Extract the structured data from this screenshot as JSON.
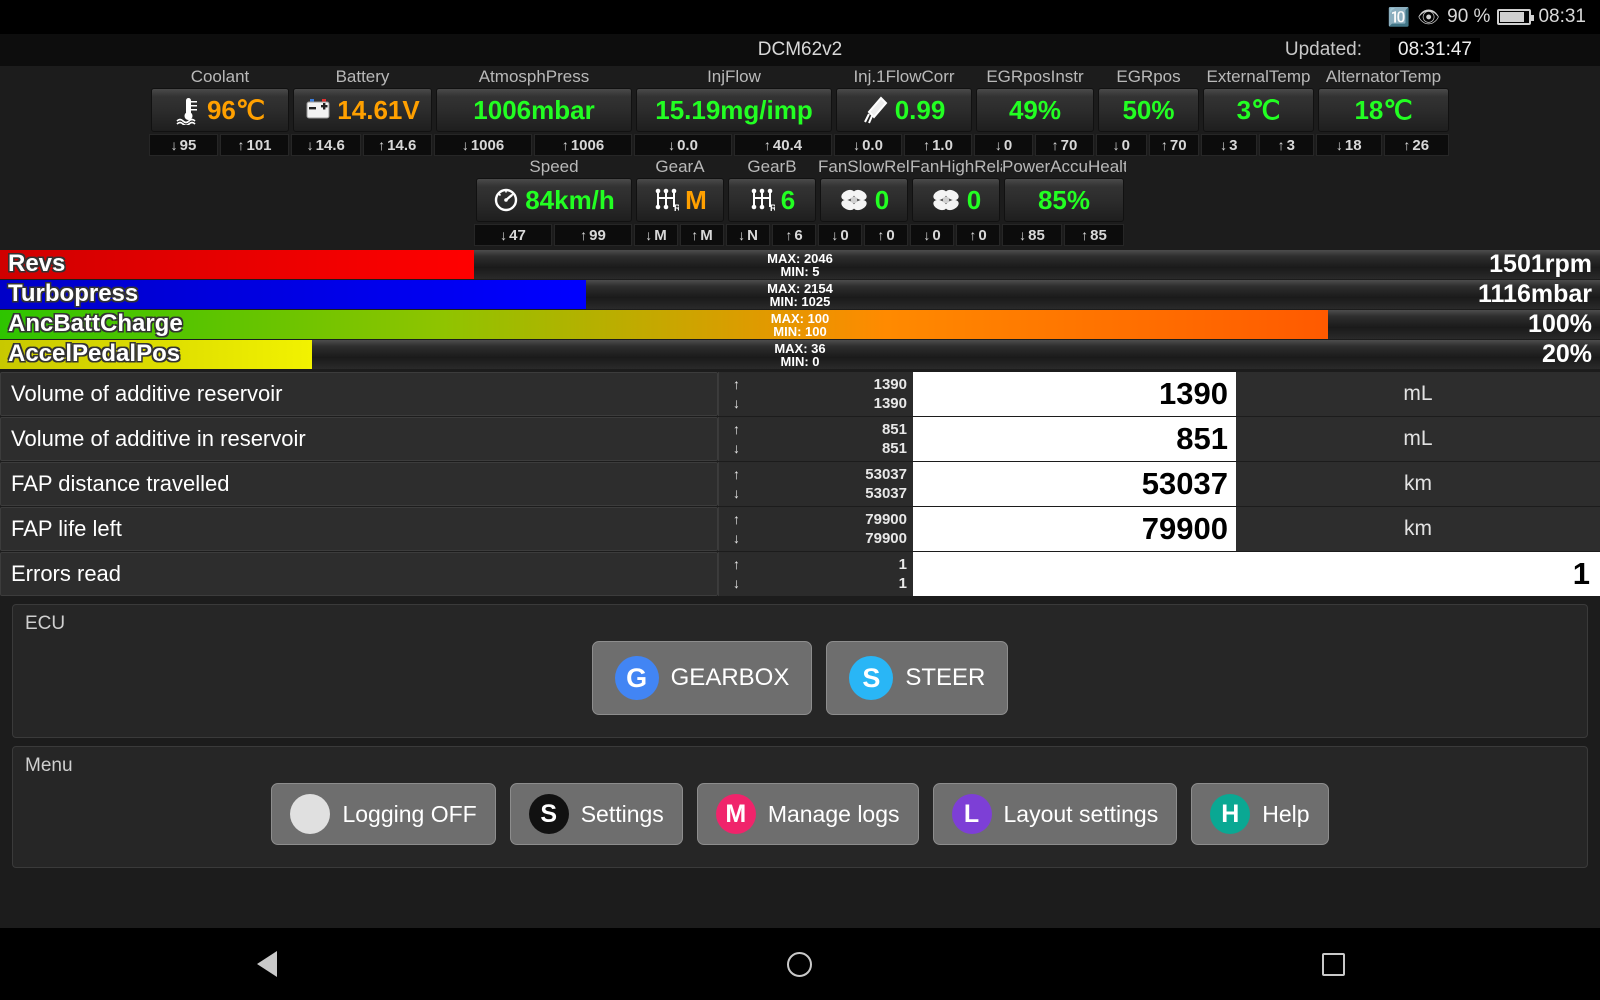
{
  "status_bar": {
    "bluetooth_icon": "bluetooth-icon",
    "eye_icon": "eye-icon",
    "battery_percent": "90 %",
    "clock": "08:31"
  },
  "header": {
    "ecu_name": "DCM62v2",
    "updated_label": "Updated:",
    "updated_time": "08:31:47"
  },
  "gauges_row1": [
    {
      "label": "Coolant",
      "value": "96℃",
      "color": "orange",
      "icon": "thermometer-icon",
      "min": "95",
      "max": "101"
    },
    {
      "label": "Battery",
      "value": "14.61V",
      "color": "orange",
      "icon": "battery-icon",
      "min": "14.6",
      "max": "14.6"
    },
    {
      "label": "AtmosphPress",
      "value": "1006mbar",
      "color": "green",
      "icon": "",
      "min": "1006",
      "max": "1006"
    },
    {
      "label": "InjFlow",
      "value": "15.19mg/imp",
      "color": "green",
      "icon": "",
      "min": "0.0",
      "max": "40.4"
    },
    {
      "label": "Inj.1FlowCorr",
      "value": "0.99",
      "color": "green",
      "icon": "injector-icon",
      "min": "0.0",
      "max": "1.0"
    },
    {
      "label": "EGRposInstr",
      "value": "49%",
      "color": "green",
      "icon": "",
      "min": "0",
      "max": "70"
    },
    {
      "label": "EGRpos",
      "value": "50%",
      "color": "green",
      "icon": "",
      "min": "0",
      "max": "70"
    },
    {
      "label": "ExternalTemp",
      "value": "3℃",
      "color": "green",
      "icon": "",
      "min": "3",
      "max": "3"
    },
    {
      "label": "AlternatorTemp",
      "value": "18℃",
      "color": "green",
      "icon": "",
      "min": "18",
      "max": "26"
    }
  ],
  "gauges_row2": [
    {
      "label": "Speed",
      "value": "84km/h",
      "color": "green",
      "icon": "speedometer-icon",
      "min": "47",
      "max": "99"
    },
    {
      "label": "GearA",
      "value": "M",
      "color": "orange",
      "icon": "gearstick-icon",
      "min": "M",
      "max": "M"
    },
    {
      "label": "GearB",
      "value": "6",
      "color": "green",
      "icon": "gearstick-icon",
      "min": "N",
      "max": "6"
    },
    {
      "label": "FanSlowRelay",
      "value": "0",
      "color": "green",
      "icon": "fan-icon",
      "min": "0",
      "max": "0"
    },
    {
      "label": "FanHighRelay",
      "value": "0",
      "color": "green",
      "icon": "fan-icon",
      "min": "0",
      "max": "0"
    },
    {
      "label": "PowerAccuHealth",
      "value": "85%",
      "color": "green",
      "icon": "",
      "min": "85",
      "max": "85"
    }
  ],
  "bar_gauges": [
    {
      "name": "Revs",
      "value": "1501rpm",
      "max_label": "MAX: 2046",
      "min_label": "MIN: 5",
      "fill_percent": 29.6,
      "fill_css": "linear-gradient(to right,#d00000,#ff0000)"
    },
    {
      "name": "Turbopress",
      "value": "1116mbar",
      "max_label": "MAX: 2154",
      "min_label": "MIN: 1025",
      "fill_percent": 36.6,
      "fill_css": "linear-gradient(to right,#0000c8,#0000ff)"
    },
    {
      "name": "AncBattCharge",
      "value": "100%",
      "max_label": "MAX: 100",
      "min_label": "MIN: 100",
      "fill_percent": 83.0,
      "fill_css": "linear-gradient(to right,#2ec400,#8fc400,#ff8a00,#ff5a00)"
    },
    {
      "name": "AccelPedalPos",
      "value": "20%",
      "max_label": "MAX: 36",
      "min_label": "MIN: 0",
      "fill_percent": 19.5,
      "fill_css": "linear-gradient(to right,#c8c800,#f2f200)"
    }
  ],
  "data_rows": [
    {
      "name": "Volume of additive reservoir",
      "max": "1390",
      "min": "1390",
      "value": "1390",
      "unit": "mL",
      "wide": false
    },
    {
      "name": "Volume of additive in reservoir",
      "max": "851",
      "min": "851",
      "value": "851",
      "unit": "mL",
      "wide": false
    },
    {
      "name": "FAP distance travelled",
      "max": "53037",
      "min": "53037",
      "value": "53037",
      "unit": "km",
      "wide": false
    },
    {
      "name": "FAP life left",
      "max": "79900",
      "min": "79900",
      "value": "79900",
      "unit": "km",
      "wide": false
    },
    {
      "name": "Errors read",
      "max": "1",
      "min": "1",
      "value": "1",
      "unit": "",
      "wide": true
    }
  ],
  "ecu_panel": {
    "title": "ECU",
    "buttons": [
      {
        "letter": "G",
        "label": "GEARBOX",
        "color": "#4285f4"
      },
      {
        "letter": "S",
        "label": "STEER",
        "color": "#29b6f6"
      }
    ]
  },
  "menu_panel": {
    "title": "Menu",
    "buttons": [
      {
        "letter": "",
        "label": "Logging OFF",
        "color": "#e0e0e0"
      },
      {
        "letter": "S",
        "label": "Settings",
        "color": "#111111"
      },
      {
        "letter": "M",
        "label": "Manage logs",
        "color": "#f0246b"
      },
      {
        "letter": "L",
        "label": "Layout settings",
        "color": "#7d3fd6"
      },
      {
        "letter": "H",
        "label": "Help",
        "color": "#0aa893"
      }
    ]
  },
  "navbar": {
    "back_icon": "back-triangle-icon",
    "home_icon": "home-circle-icon",
    "recents_icon": "recents-square-icon"
  }
}
